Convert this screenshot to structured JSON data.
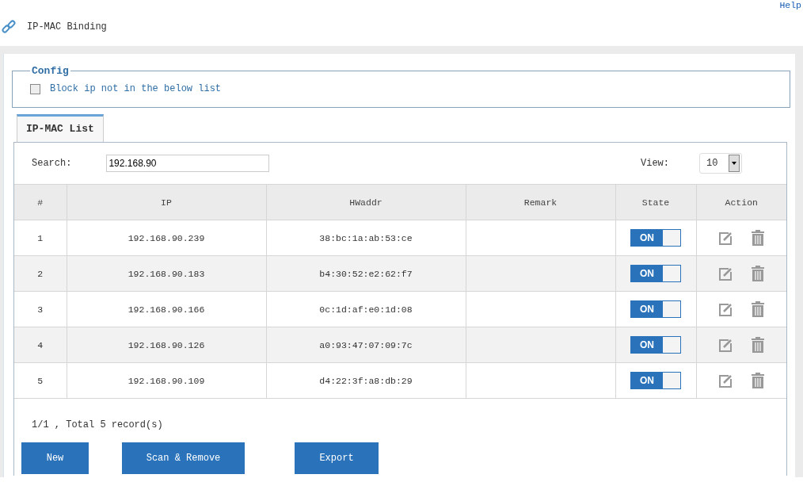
{
  "help_link": "Help",
  "page_title": "IP-MAC Binding",
  "config": {
    "legend": "Config",
    "block_option": {
      "label": "Block ip not in the below list",
      "checked": false
    }
  },
  "tabs": [
    {
      "label": "IP-MAC List",
      "selected": true
    }
  ],
  "search": {
    "label": "Search:",
    "value": "192.168.90"
  },
  "view": {
    "label": "View:",
    "value": "10"
  },
  "table": {
    "columns": [
      "#",
      "IP",
      "HWaddr",
      "Remark",
      "State",
      "Action"
    ],
    "rows": [
      {
        "index": "1",
        "ip": "192.168.90.239",
        "hwaddr": "38:bc:1a:ab:53:ce",
        "state": {
          "label": "ON",
          "on": true
        }
      },
      {
        "index": "2",
        "ip": "192.168.90.183",
        "hwaddr": "b4:30:52:e2:62:f7",
        "state": {
          "label": "ON",
          "on": true
        }
      },
      {
        "index": "3",
        "ip": "192.168.90.166",
        "hwaddr": "0c:1d:af:e0:1d:08",
        "state": {
          "label": "ON",
          "on": true
        }
      },
      {
        "index": "4",
        "ip": "192.168.90.126",
        "hwaddr": "a0:93:47:07:09:7c",
        "state": {
          "label": "ON",
          "on": true
        }
      },
      {
        "index": "5",
        "ip": "192.168.90.109",
        "hwaddr": "d4:22:3f:a8:db:29",
        "state": {
          "label": "ON",
          "on": true
        }
      }
    ]
  },
  "pagination": "1/1 , Total 5 record(s)",
  "buttons": [
    "New",
    "Scan & Remove",
    "Export"
  ]
}
